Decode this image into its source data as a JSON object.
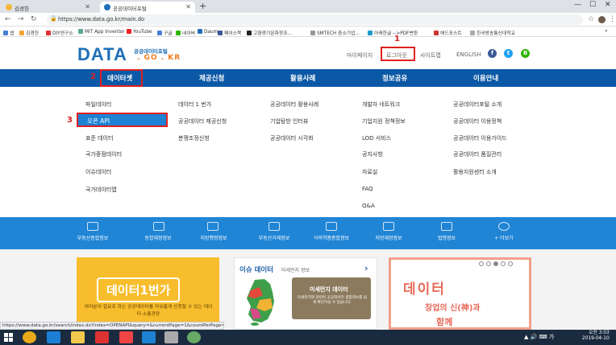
{
  "browser": {
    "tabs": [
      {
        "title": "김경헌",
        "active": false
      },
      {
        "title": "공공데이터포털",
        "active": true
      }
    ],
    "new_tab": "+",
    "window_buttons": [
      "—",
      "☐",
      "✕"
    ],
    "url": "https://www.data.go.kr/main.do",
    "bookmarks": [
      "앱",
      "김경헌",
      "DIY연구소",
      "MIT App Inventor",
      "YouTube",
      "구글",
      "네이버",
      "Daum",
      "페이스북",
      "고향경기문화창조...",
      "SMTECH 중소기업...",
      "아래한글 -->PDF변환",
      "애드포스트",
      "한국방송통신대학교"
    ],
    "more_bookmarks": "»",
    "status_url": "https://www.data.go.kr/search/index.do?index=OPENAPI&query=&currentPage=1&countPerPage=10"
  },
  "site": {
    "logo_text": "DATA",
    "logo_sub1": "공공데이터포털",
    "logo_sub2": ". GO . KR",
    "util_links": [
      "마이페이지",
      "로그아웃",
      "사이트맵",
      "ENGLISH"
    ],
    "sns": [
      "f",
      "t",
      "B"
    ],
    "gnb": [
      "데이터셋",
      "제공신청",
      "활용사례",
      "정보공유",
      "이용안내"
    ]
  },
  "mega_menu": {
    "col1": [
      "파일데이터",
      "오픈 API",
      "표준 데이터",
      "국가중점데이터",
      "이슈데이터",
      "국가데이터맵"
    ],
    "col2": [
      "데이터 1 번가",
      "공공데이터 제공신청",
      "분쟁조정신청"
    ],
    "col3": [
      "공공데이터 활용사례",
      "기업탐방 인터뷰",
      "공공데이터 시각화"
    ],
    "col4": [
      "개발자 네트워크",
      "기업지원 정책정보",
      "LOD 서비스",
      "공지사항",
      "자료실",
      "FAQ",
      "Q&A"
    ],
    "col5": [
      "공공데이터포털 소개",
      "공공데이터 이용정책",
      "공공데이터 이용가이드",
      "공공데이터 품질관리",
      "활용지원센터 소개"
    ]
  },
  "annotations": [
    "1",
    "2",
    "3"
  ],
  "categories": [
    "부동산종합정보",
    "동합재정정보",
    "지방행정정보",
    "부동산거래정보",
    "식의약품종합정보",
    "지방재정정보",
    "법령정보",
    "+ 더보기"
  ],
  "banners": {
    "left_title": "데이터1번가",
    "left_desc": "여러분이 필요로 하는 공공데이터를 자유롭게 신청할 수 있는 데이터 소통광장",
    "issue_title": "이슈 데이터",
    "issue_sub": "미세먼지 정보",
    "issue_arrow": "›",
    "dust_title": "미세먼지 데이터",
    "dust_desc": "미세먼지와 관련된 공공데이터 결합정보를 쉽게 확인하실 수 있습니다.",
    "startup_title": "데이터",
    "startup_line2": "창업의 신(神)과",
    "startup_line3": "함께"
  },
  "taskbar": {
    "tray": "▲ 🔊 ⌨ 가",
    "time": "오전 3:03",
    "date": "2019-04-10"
  },
  "colors": {
    "brand_blue": "#0b59a6",
    "band_blue": "#2185d5",
    "highlight": "#1d82d4",
    "annotation_red": "#e02020",
    "accent_orange": "#f07c1c"
  }
}
